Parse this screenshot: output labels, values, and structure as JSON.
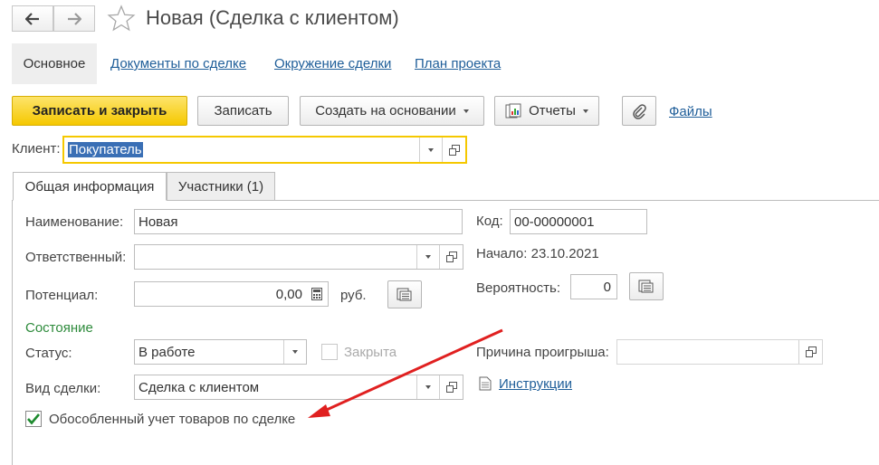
{
  "window": {
    "title": "Новая (Сделка с клиентом)"
  },
  "nav_tabs": {
    "main": "Основное",
    "deal_docs": "Документы по сделке",
    "environment": "Окружение сделки",
    "project_plan": "План проекта"
  },
  "toolbar": {
    "save_close": "Записать и закрыть",
    "save": "Записать",
    "create_based": "Создать на основании",
    "reports": "Отчеты",
    "files": "Файлы"
  },
  "client": {
    "label": "Клиент:",
    "value": "Покупатель"
  },
  "tabs": {
    "general": "Общая информация",
    "participants": "Участники (1)"
  },
  "form": {
    "name_label": "Наименование:",
    "name_value": "Новая",
    "code_label": "Код:",
    "code_value": "00-00000001",
    "responsible_label": "Ответственный:",
    "responsible_value": "",
    "start_text": "Начало: 23.10.2021",
    "potential_label": "Потенциал:",
    "potential_value": "0,00",
    "currency": "руб.",
    "probability_label": "Вероятность:",
    "probability_value": "0",
    "state_section": "Состояние",
    "status_label": "Статус:",
    "status_value": "В работе",
    "closed_label": "Закрыта",
    "loss_reason_label": "Причина проигрыша:",
    "loss_reason_value": "",
    "deal_type_label": "Вид сделки:",
    "deal_type_value": "Сделка с клиентом",
    "instructions": "Инструкции",
    "separate_accounting_label": "Обособленный учет товаров по сделке",
    "separate_accounting_checked": true,
    "closed_checked": false
  },
  "colors": {
    "accent_yellow": "#f5c800",
    "link": "#1f5e99",
    "section": "#2e8b3c",
    "arrow": "#e02020"
  },
  "icons": [
    "back-arrow-icon",
    "forward-arrow-icon",
    "star-icon",
    "paperclip-icon",
    "reports-icon",
    "calculator-icon",
    "open-form-icon",
    "document-icon"
  ]
}
